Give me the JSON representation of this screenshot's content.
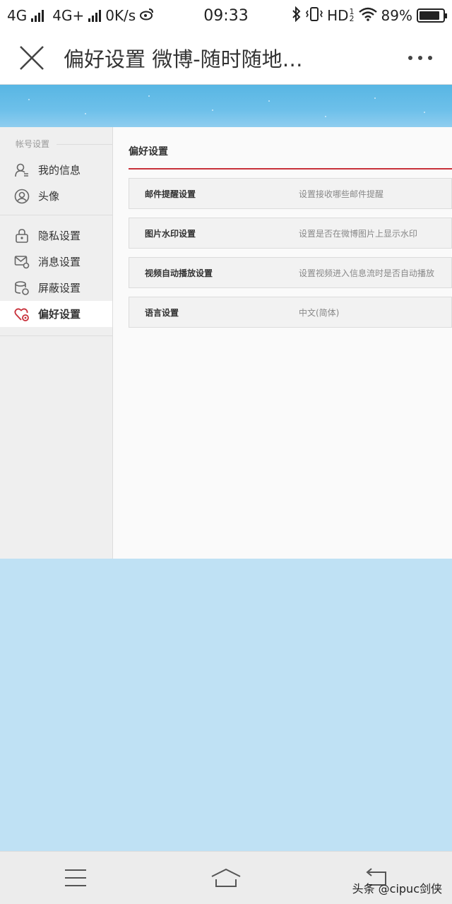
{
  "status_bar": {
    "signal1": "4G",
    "signal2": "4G+",
    "speed": "0K/s",
    "time": "09:33",
    "hd": "HD",
    "hd_sup": "1",
    "hd_sub": "2",
    "battery_percent": "89%",
    "battery_level": 0.89
  },
  "title_bar": {
    "title": "偏好设置 微博-随时随地…",
    "icons": [
      "close-icon",
      "more-icon"
    ]
  },
  "sidebar": {
    "group_title": "帐号设置",
    "items": [
      {
        "label": "我的信息",
        "icon": "user-info-icon"
      },
      {
        "label": "头像",
        "icon": "avatar-icon"
      },
      {
        "label": "隐私设置",
        "icon": "lock-icon"
      },
      {
        "label": "消息设置",
        "icon": "message-settings-icon"
      },
      {
        "label": "屏蔽设置",
        "icon": "block-settings-icon"
      },
      {
        "label": "偏好设置",
        "icon": "heart-gear-icon"
      }
    ],
    "active": "偏好设置"
  },
  "content": {
    "title": "偏好设置",
    "rows": [
      {
        "name": "邮件提醒设置",
        "desc": "设置接收哪些邮件提醒"
      },
      {
        "name": "图片水印设置",
        "desc": "设置是否在微博图片上显示水印"
      },
      {
        "name": "视频自动播放设置",
        "desc": "设置视频进入信息流时是否自动播放"
      },
      {
        "name": "语言设置",
        "desc": "中文(简体)"
      }
    ]
  },
  "nav_bar": {
    "icons": [
      "menu-icon",
      "home-icon",
      "back-icon"
    ]
  },
  "watermark": "头条 @cipuc剑侠",
  "colors": {
    "accent": "#c8303a",
    "banner": "#6dc0ea",
    "background_blue": "#bfe1f4"
  }
}
